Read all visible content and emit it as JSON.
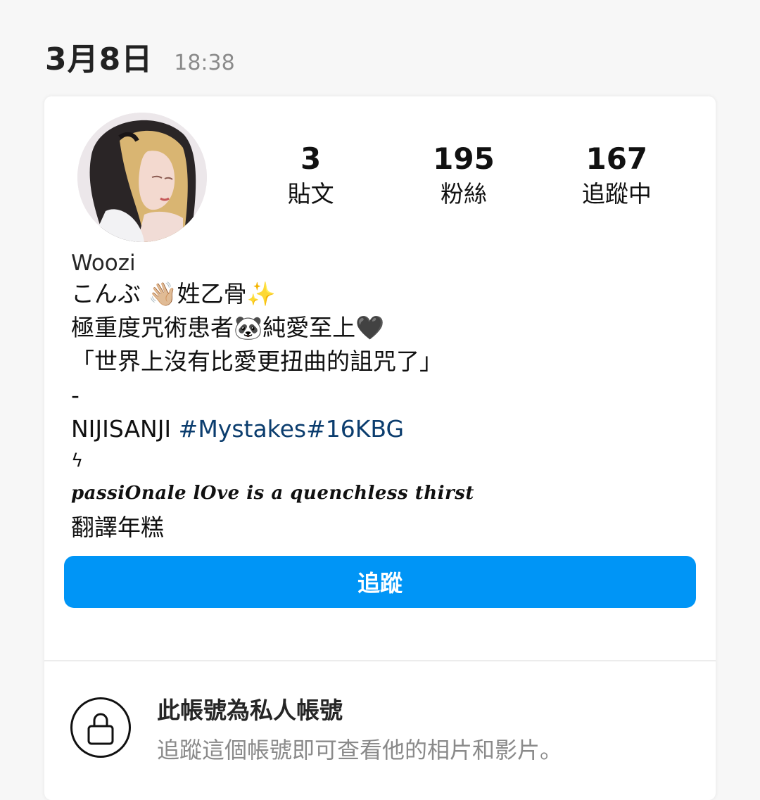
{
  "header": {
    "date": "3月8日",
    "time": "18:38"
  },
  "profile": {
    "avatar_icon": "profile-avatar",
    "stats": [
      {
        "value": "3",
        "label": "貼文"
      },
      {
        "value": "195",
        "label": "粉絲"
      },
      {
        "value": "167",
        "label": "追蹤中"
      }
    ],
    "name": "Woozi",
    "bio": {
      "line1": "こんぶ 👋🏼姓乙骨✨",
      "line2": "極重度咒術患者🐼純愛至上🖤",
      "line3": "「世界上沒有比愛更扭曲的詛咒了」",
      "line4": "-",
      "line5_text": "NIJISANJI ",
      "line5_hashtags": "#Mystakes#16KBG",
      "line6": "ϟ",
      "line7": "passiOnale lOve is a quenchless thirst",
      "line8": "翻譯年糕"
    }
  },
  "follow_button": {
    "label": "追蹤",
    "color": "#0095f6"
  },
  "private_notice": {
    "icon": "lock-icon",
    "title": "此帳號為私人帳號",
    "subtitle": "追蹤這個帳號即可查看他的相片和影片。"
  }
}
